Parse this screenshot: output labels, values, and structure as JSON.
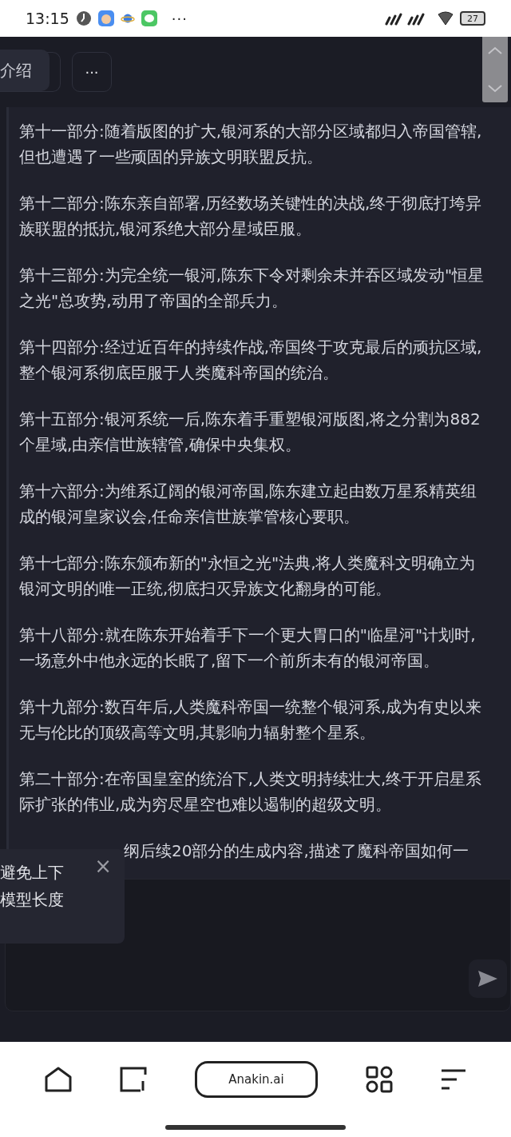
{
  "status_bar": {
    "time": "13:15",
    "more": "···",
    "battery": "27"
  },
  "header": {
    "tooltip": "介绍",
    "more_button": "···"
  },
  "paragraphs": [
    "第十一部分:随着版图的扩大,银河系的大部分区域都归入帝国管辖,但也遭遇了一些顽固的异族文明联盟反抗。",
    "第十二部分:陈东亲自部署,历经数场关键性的决战,终于彻底打垮异族联盟的抵抗,银河系绝大部分星域臣服。",
    "第十三部分:为完全统一银河,陈东下令对剩余未并吞区域发动\"恒星之光\"总攻势,动用了帝国的全部兵力。",
    "第十四部分:经过近百年的持续作战,帝国终于攻克最后的顽抗区域,整个银河系彻底臣服于人类魔科帝国的统治。",
    "第十五部分:银河系统一后,陈东着手重塑银河版图,将之分割为882个星域,由亲信世族辖管,确保中央集权。",
    "第十六部分:为维系辽阔的银河帝国,陈东建立起由数万星系精英组成的银河皇家议会,任命亲信世族掌管核心要职。",
    "第十七部分:陈东颁布新的\"永恒之光\"法典,将人类魔科文明确立为银河文明的唯一正统,彻底扫灭异族文化翻身的可能。",
    "第十八部分:就在陈东开始着手下一个更大胃口的\"临星河\"计划时,一场意外中他永远的长眠了,留下一个前所未有的银河帝国。",
    "第十九部分:数百年后,人类魔科帝国一统整个银河系,成为有史以来无与伦比的顶级高等文明,其影响力辐射整个星系。",
    "第二十部分:在帝国皇室的统治下,人类文明持续壮大,终于开启星系际扩张的伟业,成为穷尽星空也难以遏制的超级文明。"
  ],
  "partial_paragraph": "纲后续20部分的生成内容,描述了魔科帝国如何一",
  "toast": {
    "lines": [
      "避免上下",
      "模型长度"
    ],
    "close": "×"
  },
  "browser_bar": {
    "address": "Anakin.ai"
  }
}
